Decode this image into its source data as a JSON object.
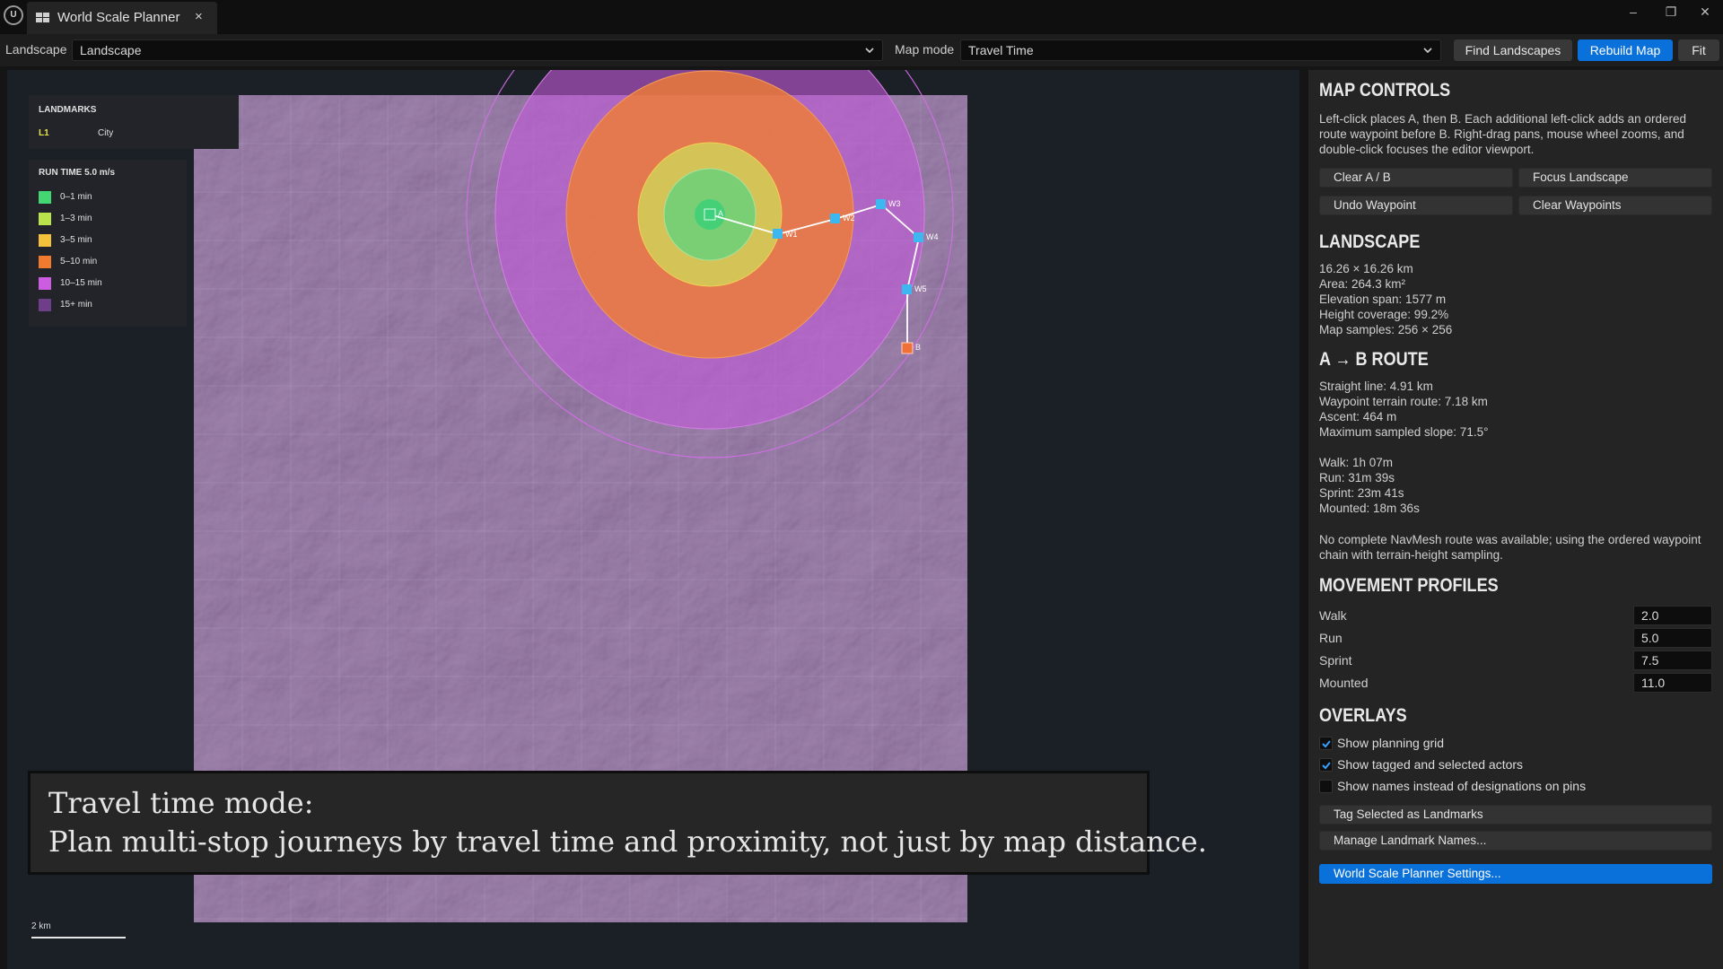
{
  "window": {
    "tab_title": "World Scale Planner",
    "tab_close": "×",
    "minimize": "–",
    "restore": "❐",
    "close": "✕"
  },
  "toolbar": {
    "landscape_label": "Landscape",
    "landscape_value": "Landscape",
    "map_mode_label": "Map mode",
    "map_mode_value": "Travel Time",
    "find_button": "Find Landscapes",
    "rebuild_button": "Rebuild Map",
    "fit_button": "Fit"
  },
  "legend": {
    "landmarks_title": "LANDMARKS",
    "landmarks": [
      {
        "designation": "L1",
        "name": "City"
      }
    ],
    "run_time_title": "RUN TIME  5.0 m/s",
    "bands": [
      {
        "label": "0–1 min",
        "color": "#42d772"
      },
      {
        "label": "1–3 min",
        "color": "#b9e34a"
      },
      {
        "label": "3–5 min",
        "color": "#f4c23a"
      },
      {
        "label": "5–10 min",
        "color": "#f07a2e"
      },
      {
        "label": "10–15 min",
        "color": "#cc5ce0"
      },
      {
        "label": "15+ min",
        "color": "#6e3f88"
      }
    ]
  },
  "map": {
    "pins": {
      "a": "A",
      "b": "B"
    },
    "waypoints": [
      "W1",
      "W2",
      "W3",
      "W4",
      "W5"
    ],
    "scale_label": "2 km"
  },
  "caption": {
    "line1": "Travel time mode:",
    "line2": "Plan multi-stop journeys by travel time and proximity, not just by map distance."
  },
  "panel": {
    "map_controls": {
      "title": "MAP CONTROLS",
      "help": [
        "Left-click places A, then B. Each additional left-click adds an ordered",
        "route waypoint before B. Right-drag pans, mouse wheel zooms, and",
        "double-click focuses the editor viewport."
      ],
      "clear_ab": "Clear A / B",
      "focus_landscape": "Focus Landscape",
      "undo_waypoint": "Undo Waypoint",
      "clear_waypoints": "Clear Waypoints"
    },
    "landscape": {
      "title": "LANDSCAPE",
      "lines": [
        "16.26 × 16.26 km",
        "Area: 264.3 km²",
        "Elevation span: 1577 m",
        "Height coverage: 99.2%",
        "Map samples: 256 × 256"
      ]
    },
    "route": {
      "title": "A → B ROUTE",
      "stats": [
        "Straight line: 4.91 km",
        "Waypoint terrain route: 7.18 km",
        "Ascent: 464 m",
        "Maximum sampled slope: 71.5°"
      ],
      "times": [
        "Walk: 1h 07m",
        "Run: 31m 39s",
        "Sprint: 23m 41s",
        "Mounted: 18m 36s"
      ],
      "note": [
        "No complete NavMesh route was available; using the ordered waypoint",
        "chain with terrain-height sampling."
      ]
    },
    "movement": {
      "title": "MOVEMENT PROFILES",
      "profiles": [
        {
          "label": "Walk",
          "value": "2.0"
        },
        {
          "label": "Run",
          "value": "5.0"
        },
        {
          "label": "Sprint",
          "value": "7.5"
        },
        {
          "label": "Mounted",
          "value": "11.0"
        }
      ]
    },
    "overlays": {
      "title": "OVERLAYS",
      "options": [
        {
          "label": "Show planning grid",
          "checked": true
        },
        {
          "label": "Show tagged and selected actors",
          "checked": true
        },
        {
          "label": "Show names instead of designations on pins",
          "checked": false
        }
      ],
      "tag_button": "Tag Selected as Landmarks",
      "manage_button": "Manage Landmark Names...",
      "settings_button": "World Scale Planner Settings..."
    }
  }
}
